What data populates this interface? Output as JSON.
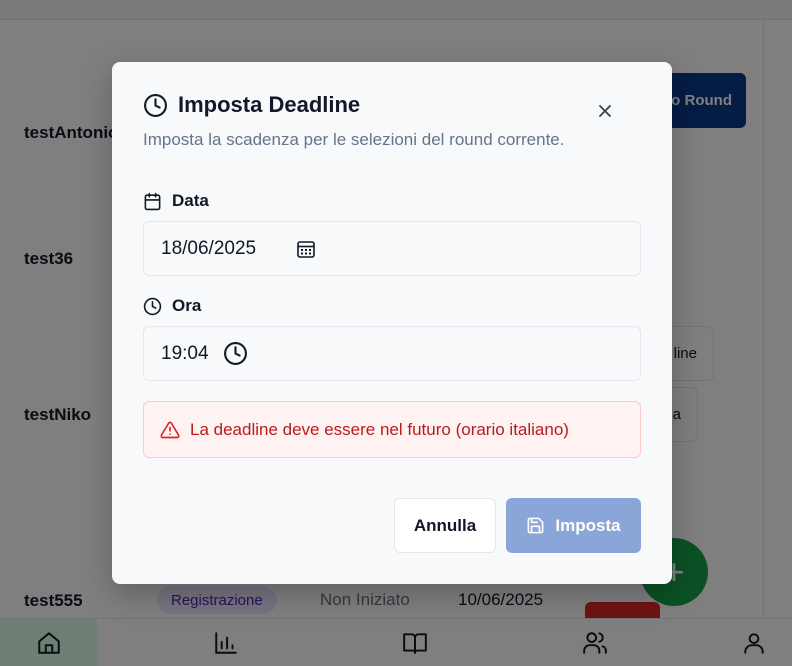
{
  "background": {
    "rows": [
      {
        "name": "testAntonio"
      },
      {
        "name": "test36"
      },
      {
        "name": "testNiko"
      },
      {
        "name": "test555",
        "status_badge": "Registrazione",
        "state": "Non Iniziato",
        "date": "10/06/2025"
      }
    ],
    "buttons": {
      "new_round_label": "o Round",
      "deadline_label": "line",
      "other_label": "a"
    },
    "fab_label": "+",
    "bottom_nav": {
      "items": [
        {
          "icon": "home-icon",
          "active": true
        },
        {
          "icon": "bar-chart-icon",
          "active": false
        },
        {
          "icon": "book-icon",
          "active": false
        },
        {
          "icon": "users-icon",
          "active": false
        },
        {
          "icon": "user-icon",
          "active": false
        }
      ]
    }
  },
  "modal": {
    "title": "Imposta Deadline",
    "title_icon": "clock-icon",
    "description": "Imposta la scadenza per le selezioni del round corrente.",
    "date_field": {
      "label": "Data",
      "icon": "calendar-icon",
      "value": "18/06/2025"
    },
    "time_field": {
      "label": "Ora",
      "icon": "clock-icon",
      "value": "19:04"
    },
    "error": {
      "icon": "alert-triangle-icon",
      "message": "La deadline deve essere nel futuro (orario italiano)"
    },
    "cancel_label": "Annulla",
    "submit_label": "Imposta",
    "submit_icon": "save-icon"
  },
  "colors": {
    "overlay": "rgba(0,0,0,0.5)",
    "primary_disabled": "#8aa5d8",
    "error_bg": "#fef2f2",
    "error_text": "#b91c1c",
    "nav_active": "#dcfce7",
    "fab": "#16a34a"
  }
}
